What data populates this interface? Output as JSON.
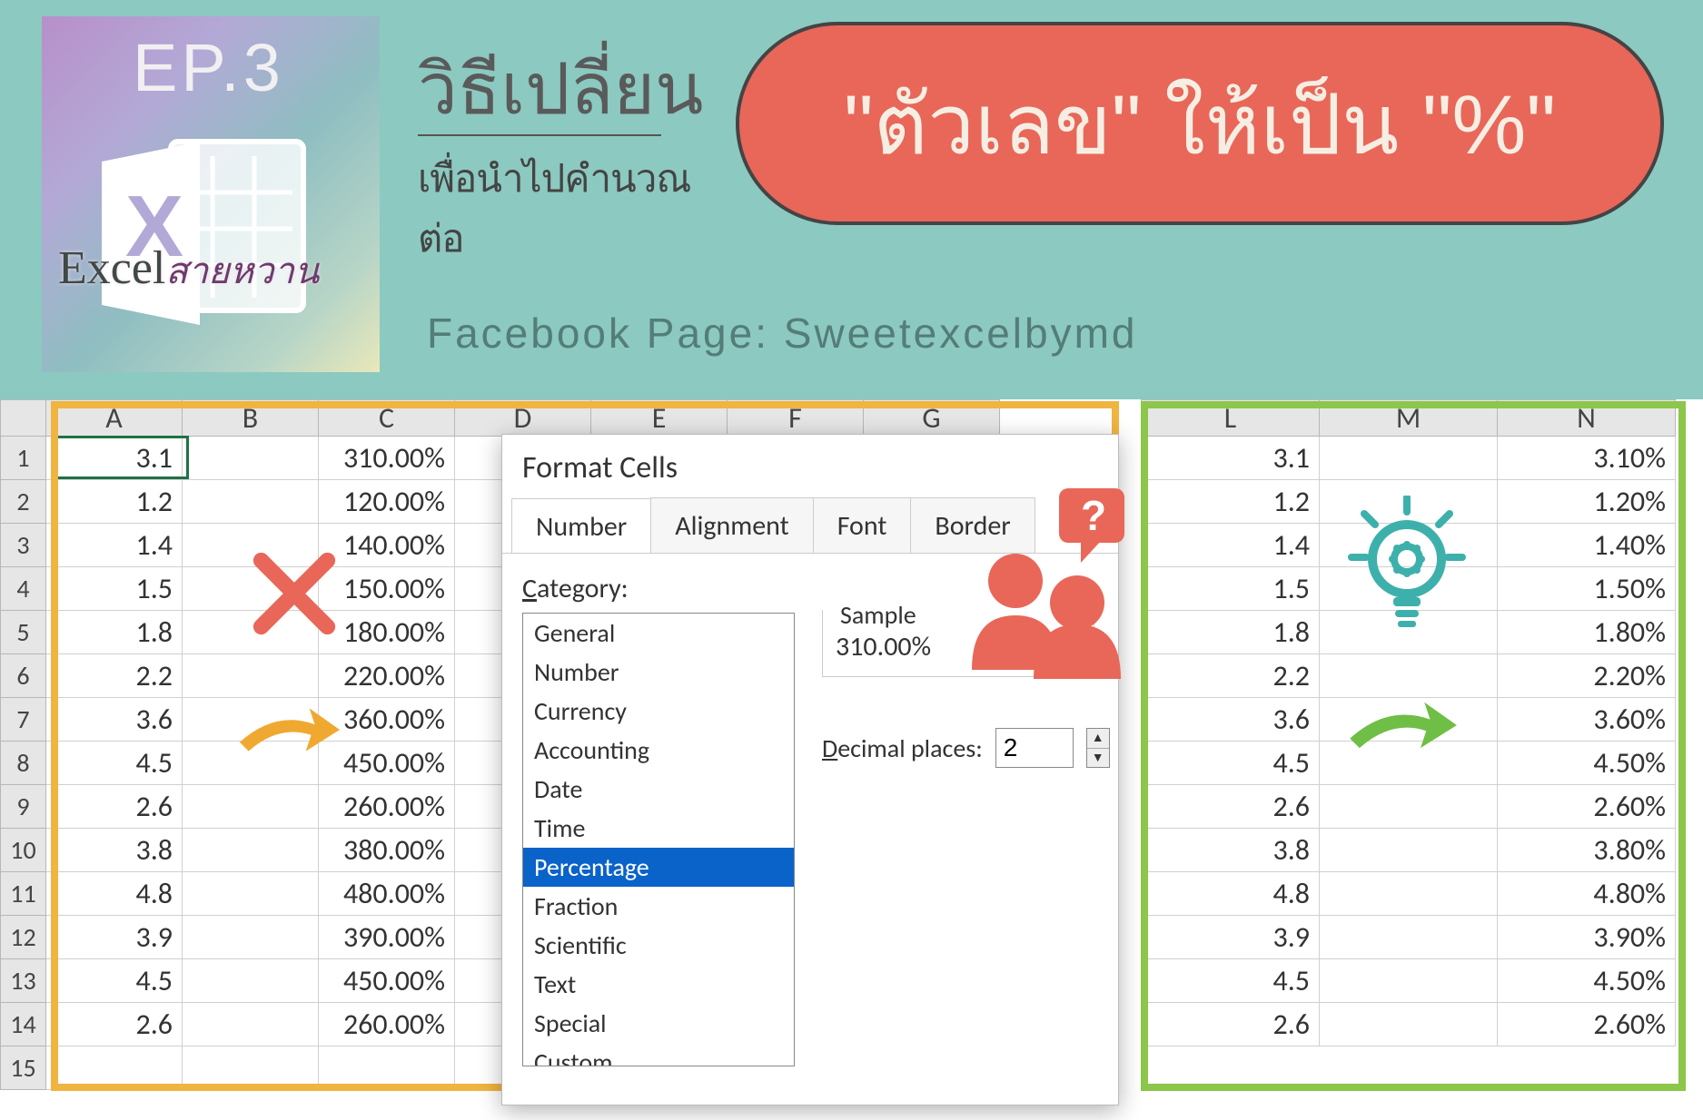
{
  "header": {
    "episode": "EP.3",
    "brand_main": "Excel",
    "brand_sub": "สายหวาน",
    "thai_title": "วิธีเปลี่ยน",
    "thai_sub": "เพื่อนำไปคำนวณต่อ",
    "pill_text": "\"ตัวเลข\" ให้เป็น \"%\"",
    "fb_text": "Facebook Page: Sweetexcelbymd"
  },
  "left_table": {
    "columns": [
      "A",
      "B",
      "C",
      "D",
      "E",
      "F",
      "G"
    ],
    "rows": [
      {
        "n": "1",
        "A": "3.1",
        "C": "310.00%"
      },
      {
        "n": "2",
        "A": "1.2",
        "C": "120.00%"
      },
      {
        "n": "3",
        "A": "1.4",
        "C": "140.00%"
      },
      {
        "n": "4",
        "A": "1.5",
        "C": "150.00%"
      },
      {
        "n": "5",
        "A": "1.8",
        "C": "180.00%"
      },
      {
        "n": "6",
        "A": "2.2",
        "C": "220.00%"
      },
      {
        "n": "7",
        "A": "3.6",
        "C": "360.00%"
      },
      {
        "n": "8",
        "A": "4.5",
        "C": "450.00%"
      },
      {
        "n": "9",
        "A": "2.6",
        "C": "260.00%"
      },
      {
        "n": "10",
        "A": "3.8",
        "C": "380.00%"
      },
      {
        "n": "11",
        "A": "4.8",
        "C": "480.00%"
      },
      {
        "n": "12",
        "A": "3.9",
        "C": "390.00%"
      },
      {
        "n": "13",
        "A": "4.5",
        "C": "450.00%"
      },
      {
        "n": "14",
        "A": "2.6",
        "C": "260.00%"
      },
      {
        "n": "15",
        "A": "",
        "C": ""
      }
    ]
  },
  "right_table": {
    "columns": [
      "L",
      "M",
      "N"
    ],
    "rows": [
      {
        "L": "3.1",
        "N": "3.10%"
      },
      {
        "L": "1.2",
        "N": "1.20%"
      },
      {
        "L": "1.4",
        "N": "1.40%"
      },
      {
        "L": "1.5",
        "N": "1.50%"
      },
      {
        "L": "1.8",
        "N": "1.80%"
      },
      {
        "L": "2.2",
        "N": "2.20%"
      },
      {
        "L": "3.6",
        "N": "3.60%"
      },
      {
        "L": "4.5",
        "N": "4.50%"
      },
      {
        "L": "2.6",
        "N": "2.60%"
      },
      {
        "L": "3.8",
        "N": "3.80%"
      },
      {
        "L": "4.8",
        "N": "4.80%"
      },
      {
        "L": "3.9",
        "N": "3.90%"
      },
      {
        "L": "4.5",
        "N": "4.50%"
      },
      {
        "L": "2.6",
        "N": "2.60%"
      }
    ]
  },
  "dialog": {
    "title": "Format Cells",
    "tabs": [
      "Number",
      "Alignment",
      "Font",
      "Border"
    ],
    "active_tab": "Number",
    "category_label": "Category:",
    "categories": [
      "General",
      "Number",
      "Currency",
      "Accounting",
      "Date",
      "Time",
      "Percentage",
      "Fraction",
      "Scientific",
      "Text",
      "Special",
      "Custom"
    ],
    "selected_category": "Percentage",
    "sample_label": "Sample",
    "sample_value": "310.00%",
    "decimal_label": "Decimal places:",
    "decimal_value": "2"
  }
}
